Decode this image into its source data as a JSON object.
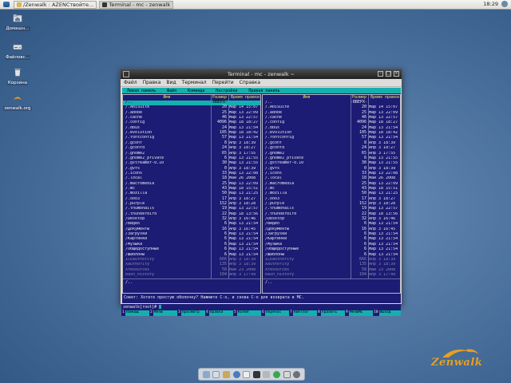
{
  "top_panel": {
    "tasks": [
      {
        "label": "/Zenwalk : AZENCтвойте…",
        "icon": "folder-icon"
      },
      {
        "label": "Terminal - mc - zenwalk",
        "icon": "terminal-icon"
      }
    ],
    "clock": "18:29"
  },
  "desktop_icons": [
    {
      "label": "Домашн…",
      "icon": "home-folder-icon"
    },
    {
      "label": "Файловс…",
      "icon": "drive-icon"
    },
    {
      "label": "Корзина",
      "icon": "trash-icon"
    },
    {
      "label": "zenwalk.org",
      "icon": "zenwalk-link-icon"
    }
  ],
  "terminal": {
    "title": "Terminal - mc - zenwalk ~",
    "menu": [
      "Файл",
      "Правка",
      "Вид",
      "Терминал",
      "Перейти",
      "Справка"
    ]
  },
  "mc": {
    "topbar": [
      "Левая панель",
      "Файл",
      "Команда",
      "Настройки",
      "Правая панель"
    ],
    "header": {
      "name": "Имя",
      "size": "Размер",
      "time": "Время правки"
    },
    "left_panel": {
      "path_bar": "/",
      "rows": [
        {
          "name": "/..",
          "size": "-ВВЕРХ-",
          "time": "",
          "selected": true
        },
        {
          "name": "/.AbiSuite",
          "size": "20",
          "time": "Мар 14 15:07"
        },
        {
          "name": "/.adobe",
          "size": "25",
          "time": "Мар 13 22:09"
        },
        {
          "name": "/.cache",
          "size": "46",
          "time": "Мар 13 22:57"
        },
        {
          "name": "/.config",
          "size": "4096",
          "time": "Мар 18 18:27"
        },
        {
          "name": "/.dbus",
          "size": "24",
          "time": "Мар 13 21:54"
        },
        {
          "name": "/.evolution",
          "size": "105",
          "time": "Мар 18 18:42"
        },
        {
          "name": "/.fontconfig",
          "size": "57",
          "time": "Мар 13 21:54"
        },
        {
          "name": "/.gconf",
          "size": "8",
          "time": "Апр  3 18:39"
        },
        {
          "name": "/.gconfd",
          "size": "24",
          "time": "Апр  3 18:27"
        },
        {
          "name": "/.gnome2",
          "size": "65",
          "time": "Апр  3 17:55"
        },
        {
          "name": "/.gnome2_private",
          "size": "6",
          "time": "Мар 13 21:55"
        },
        {
          "name": "/.gstreamer-0.10",
          "size": "30",
          "time": "Мар 13 21:55"
        },
        {
          "name": "/.gvfs",
          "size": "0",
          "time": "Апр  3 18:39"
        },
        {
          "name": "/.icons",
          "size": "33",
          "time": "Мар 13 22:08"
        },
        {
          "name": "/.local",
          "size": "18",
          "time": "Май 26  2008"
        },
        {
          "name": "/.macromedia",
          "size": "25",
          "time": "Мар 13 22:09"
        },
        {
          "name": "/.mc",
          "size": "43",
          "time": "Мар 18 15:51"
        },
        {
          "name": "/.mozilla",
          "size": "50",
          "time": "Мар 13 21:25"
        },
        {
          "name": "/.ooo3",
          "size": "17",
          "time": "Апр  3 18:27"
        },
        {
          "name": "/.purple",
          "size": "152",
          "time": "Апр  3 18:28"
        },
        {
          "name": "/.thumbnails",
          "size": "19",
          "time": "Мар 13 22:57"
        },
        {
          "name": "/.thunderbird",
          "size": "22",
          "time": "Мар 18 13:56"
        },
        {
          "name": "/Desktop",
          "size": "32",
          "time": "Апр  3 16:46"
        },
        {
          "name": "/Видео",
          "size": "6",
          "time": "Мар 13 21:54"
        },
        {
          "name": "/Документы",
          "size": "16",
          "time": "Апр  3 16:45"
        },
        {
          "name": "/Загрузки",
          "size": "6",
          "time": "Мар 13 21:54"
        },
        {
          "name": "/Картинки",
          "size": "6",
          "time": "Мар 13 21:54"
        },
        {
          "name": "/Музыка",
          "size": "6",
          "time": "Мар 13 21:54"
        },
        {
          "name": "/Общедоступные",
          "size": "6",
          "time": "Мар 13 21:54"
        },
        {
          "name": "/Шаблоны",
          "size": "6",
          "time": "Мар 13 21:54"
        },
        {
          "name": " ICEauthority",
          "size": "666",
          "time": "Апр  3 18:39",
          "dim": true
        },
        {
          "name": " Xauthority",
          "size": "135",
          "time": "Апр  3 18:39",
          "dim": true
        },
        {
          "name": " Xresources",
          "size": "58",
          "time": "Май 23  2008",
          "dim": true
        },
        {
          "name": " bash_history",
          "size": "104",
          "time": "Апр  3 17:49",
          "dim": true
        }
      ],
      "footer": "/.."
    },
    "right_panel": {
      "path_bar": "~",
      "rows": [
        {
          "name": "/..",
          "size": "-ВВЕРХ-",
          "time": "",
          "selected": false
        },
        {
          "name": "/.AbiSuite",
          "size": "20",
          "time": "Мар 14 15:07"
        },
        {
          "name": "/.adobe",
          "size": "25",
          "time": "Мар 13 22:09"
        },
        {
          "name": "/.cache",
          "size": "46",
          "time": "Мар 13 22:57"
        },
        {
          "name": "/.config",
          "size": "4096",
          "time": "Мар 18 18:27"
        },
        {
          "name": "/.dbus",
          "size": "24",
          "time": "Мар 13 21:54"
        },
        {
          "name": "/.evolution",
          "size": "105",
          "time": "Мар 18 18:42"
        },
        {
          "name": "/.fontconfig",
          "size": "57",
          "time": "Мар 13 21:54"
        },
        {
          "name": "/.gconf",
          "size": "8",
          "time": "Апр  3 18:39"
        },
        {
          "name": "/.gconfd",
          "size": "24",
          "time": "Апр  3 18:27"
        },
        {
          "name": "/.gnome2",
          "size": "65",
          "time": "Апр  3 17:55"
        },
        {
          "name": "/.gnome2_private",
          "size": "6",
          "time": "Мар 13 21:55"
        },
        {
          "name": "/.gstreamer-0.10",
          "size": "30",
          "time": "Мар 13 21:55"
        },
        {
          "name": "/.gvfs",
          "size": "0",
          "time": "Апр  3 18:39"
        },
        {
          "name": "/.icons",
          "size": "33",
          "time": "Мар 13 22:08"
        },
        {
          "name": "/.local",
          "size": "18",
          "time": "Май 26  2008"
        },
        {
          "name": "/.macromedia",
          "size": "25",
          "time": "Мар 13 22:09"
        },
        {
          "name": "/.mc",
          "size": "43",
          "time": "Мар 18 15:51"
        },
        {
          "name": "/.mozilla",
          "size": "50",
          "time": "Мар 13 21:25"
        },
        {
          "name": "/.ooo3",
          "size": "17",
          "time": "Апр  3 18:27"
        },
        {
          "name": "/.purple",
          "size": "152",
          "time": "Апр  3 18:28"
        },
        {
          "name": "/.thumbnails",
          "size": "19",
          "time": "Мар 13 22:57"
        },
        {
          "name": "/.thunderbird",
          "size": "22",
          "time": "Мар 18 13:56"
        },
        {
          "name": "/Desktop",
          "size": "32",
          "time": "Апр  3 16:46"
        },
        {
          "name": "/Видео",
          "size": "6",
          "time": "Мар 13 21:54"
        },
        {
          "name": "/Документы",
          "size": "16",
          "time": "Апр  3 16:45"
        },
        {
          "name": "/Загрузки",
          "size": "6",
          "time": "Мар 13 21:54"
        },
        {
          "name": "/Картинки",
          "size": "6",
          "time": "Мар 13 21:54"
        },
        {
          "name": "/Музыка",
          "size": "6",
          "time": "Мар 13 21:54"
        },
        {
          "name": "/Общедоступные",
          "size": "6",
          "time": "Мар 13 21:54"
        },
        {
          "name": "/Шаблоны",
          "size": "6",
          "time": "Мар 13 21:54"
        },
        {
          "name": " ICEauthority",
          "size": "666",
          "time": "Апр  3 18:39",
          "dim": true
        },
        {
          "name": " Xauthority",
          "size": "135",
          "time": "Апр  3 18:39",
          "dim": true
        },
        {
          "name": " Xresources",
          "size": "58",
          "time": "Май 23  2008",
          "dim": true
        },
        {
          "name": " bash_history",
          "size": "104",
          "time": "Апр  3 17:49",
          "dim": true
        }
      ],
      "footer": "/.."
    },
    "hint": "Совет: Хотите простую оболочку? Нажмите C-o, и снова C-o для возврата в MC.",
    "prompt": "zenwalk[root]#",
    "fkeys": [
      {
        "num": "1",
        "label": "Помощь"
      },
      {
        "num": "2",
        "label": "Меню"
      },
      {
        "num": "3",
        "label": "Просмотр"
      },
      {
        "num": "4",
        "label": "Правка"
      },
      {
        "num": "5",
        "label": "Копия"
      },
      {
        "num": "6",
        "label": "Перенос"
      },
      {
        "num": "7",
        "label": "НвКтлог"
      },
      {
        "num": "8",
        "label": "Удалить"
      },
      {
        "num": "9",
        "label": "МенюМС"
      },
      {
        "num": "10",
        "label": "Выход"
      }
    ]
  },
  "dock": {
    "icons": [
      "finder-icon",
      "email-icon",
      "folder-icon",
      "browser-icon",
      "text-editor-icon",
      "terminal-icon",
      "mixer-icon",
      "green-globe-icon",
      "chat-icon",
      "gear-icon"
    ]
  },
  "branding": {
    "logo_text": "Zenwalk",
    "accent": "#e8a020"
  },
  "colors": {
    "mc_background": "#1c1c74",
    "mc_selection": "#14b0b0",
    "mc_header": "#f0e050"
  }
}
